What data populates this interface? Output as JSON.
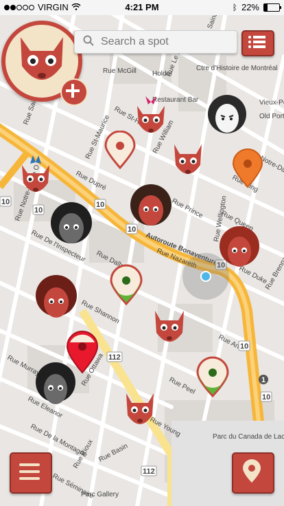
{
  "status_bar": {
    "carrier": "VIRGIN",
    "time": "4:21 PM",
    "battery": "22%"
  },
  "search": {
    "placeholder": "Search a spot"
  },
  "map": {
    "street_labels": [
      "Rue McGill",
      "Rue Saint-Louis",
      "Rue Notre-Dame O",
      "Rue St-Maurice",
      "Rue St-Henri",
      "Rue Dupré",
      "Rue William",
      "Rue Wellington",
      "Rue King",
      "Rue Queen",
      "Rue Prince",
      "Autoroute Bonaventure",
      "Rue Nazareth",
      "Rue Dalhousie",
      "Rue De l'Inspecteur",
      "Rue Shannon",
      "Rue Ottawa",
      "Rue Young",
      "Rue Murray",
      "Rue Eleanor",
      "Rue Peel",
      "Rue De la Montagne",
      "Rue Rioux",
      "Rue Basin",
      "Rue Duke",
      "Rue Ann",
      "Rue Brennan",
      "Rue Séminaire",
      "Rue Le Moyne",
      "Rue Saint-Pierre",
      "Rue Notre-Dame Ouest",
      "Holder",
      "Restaurant Bar",
      "Ctre d'Histoire de Montréal",
      "Vieux-Port de Montréal",
      "Old Port of Mont",
      "Parc du Canada de Lachine",
      "Parc Gallery"
    ],
    "route_shields": [
      "10",
      "10",
      "10",
      "10",
      "10",
      "10",
      "10",
      "112",
      "112",
      "1"
    ],
    "accent_color": "#c4473d",
    "highway_color": "#f6b63a"
  },
  "icons": {
    "menu": "hamburger-menu-icon",
    "list": "list-icon",
    "locate": "location-pin-icon",
    "add": "plus-icon",
    "search": "search-icon"
  }
}
